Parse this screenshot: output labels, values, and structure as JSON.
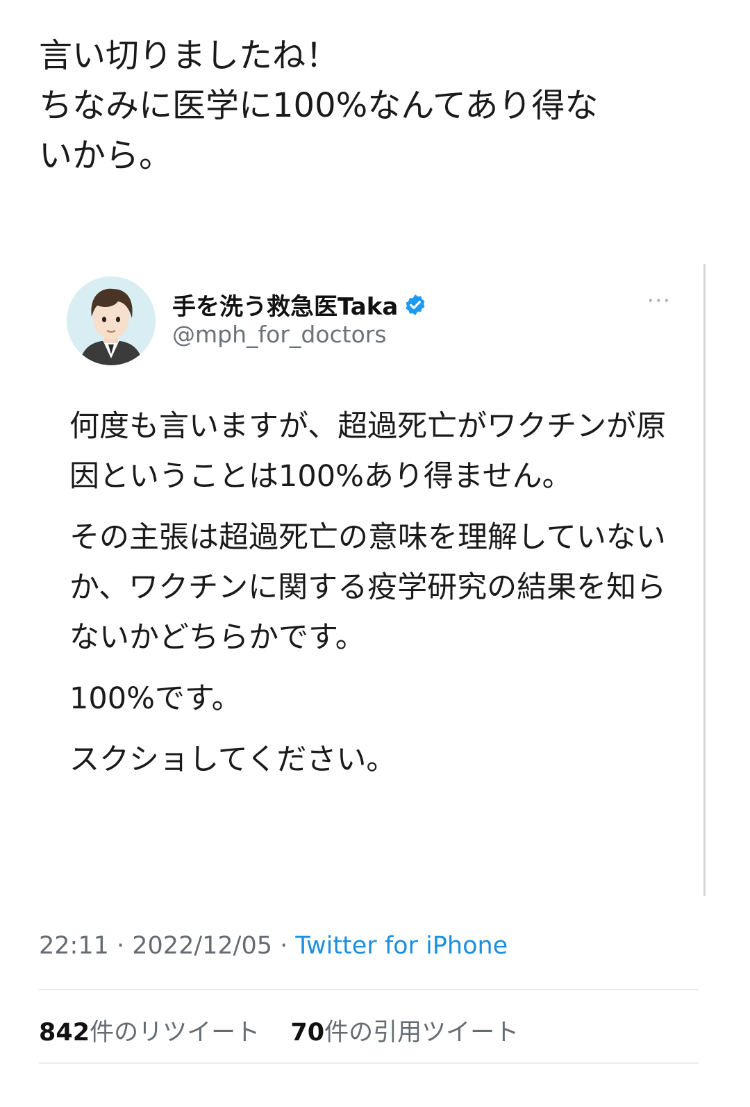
{
  "tweet": {
    "text_lines": [
      "言い切りましたね！",
      "ちなみに医学に100%なんてあり得な",
      "いから。"
    ]
  },
  "quoted_tweet": {
    "author_name": "手を洗う救急医Taka",
    "author_handle": "@mph_for_doctors",
    "verified_icon": "verified-badge-icon",
    "more_icon": "···",
    "paragraphs": [
      "何度も言いますが、超過死亡がワクチンが原因ということは100%あり得ません。",
      "その主張は超過死亡の意味を理解していないか、ワクチンに関する疫学研究の結果を知らないかどちらかです。",
      "100%です。",
      "スクショしてください。"
    ]
  },
  "meta": {
    "time": "22:11",
    "separator": " · ",
    "date": "2022/12/05",
    "source": "Twitter for iPhone"
  },
  "stats": {
    "retweets_count": "842",
    "retweets_label": "件のリツイート",
    "quotes_count": "70",
    "quotes_label": "件の引用ツイート"
  },
  "colors": {
    "link": "#1d8fe0",
    "verified": "#1d9bf0",
    "secondary_text": "#666c72"
  }
}
